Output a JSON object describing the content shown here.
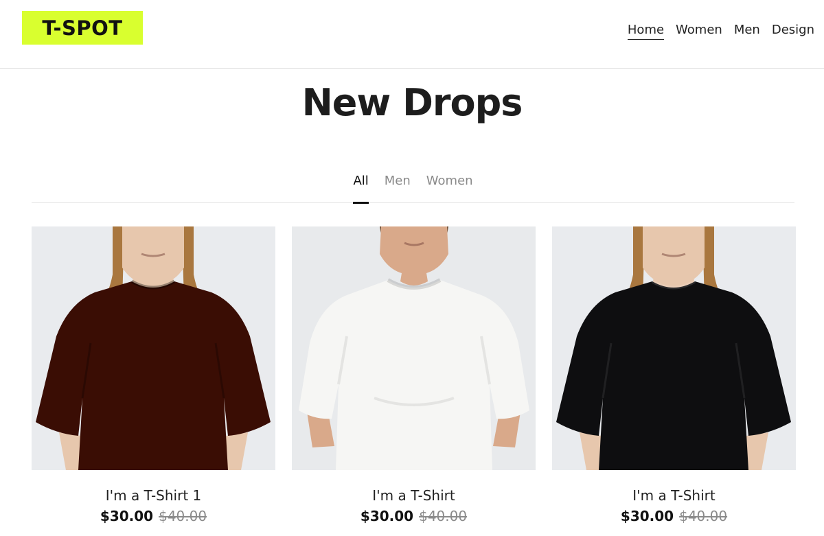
{
  "brand": {
    "logo_text": "T-SPOT",
    "accent": "#d9ff2f"
  },
  "nav": {
    "items": [
      "Home",
      "Women",
      "Men",
      "Design"
    ],
    "active": "Home"
  },
  "page": {
    "title": "New Drops"
  },
  "filters": {
    "tabs": [
      "All",
      "Men",
      "Women"
    ],
    "active": "All"
  },
  "products": [
    {
      "name": "I'm a T-Shirt 1",
      "price": "$30.00",
      "old_price": "$40.00",
      "shirt_color": "#3a0d04",
      "bg_color": "#e9ebee",
      "skin": "#e7c7ad",
      "hair": "#a9773f"
    },
    {
      "name": "I'm a T-Shirt",
      "price": "$30.00",
      "old_price": "$40.00",
      "shirt_color": "#f6f6f4",
      "bg_color": "#e8eaec",
      "skin": "#d9a98a",
      "hair": "#6b4a30"
    },
    {
      "name": "I'm a T-Shirt",
      "price": "$30.00",
      "old_price": "$40.00",
      "shirt_color": "#0e0e10",
      "bg_color": "#e9ebee",
      "skin": "#e7c7ad",
      "hair": "#a9773f"
    }
  ]
}
